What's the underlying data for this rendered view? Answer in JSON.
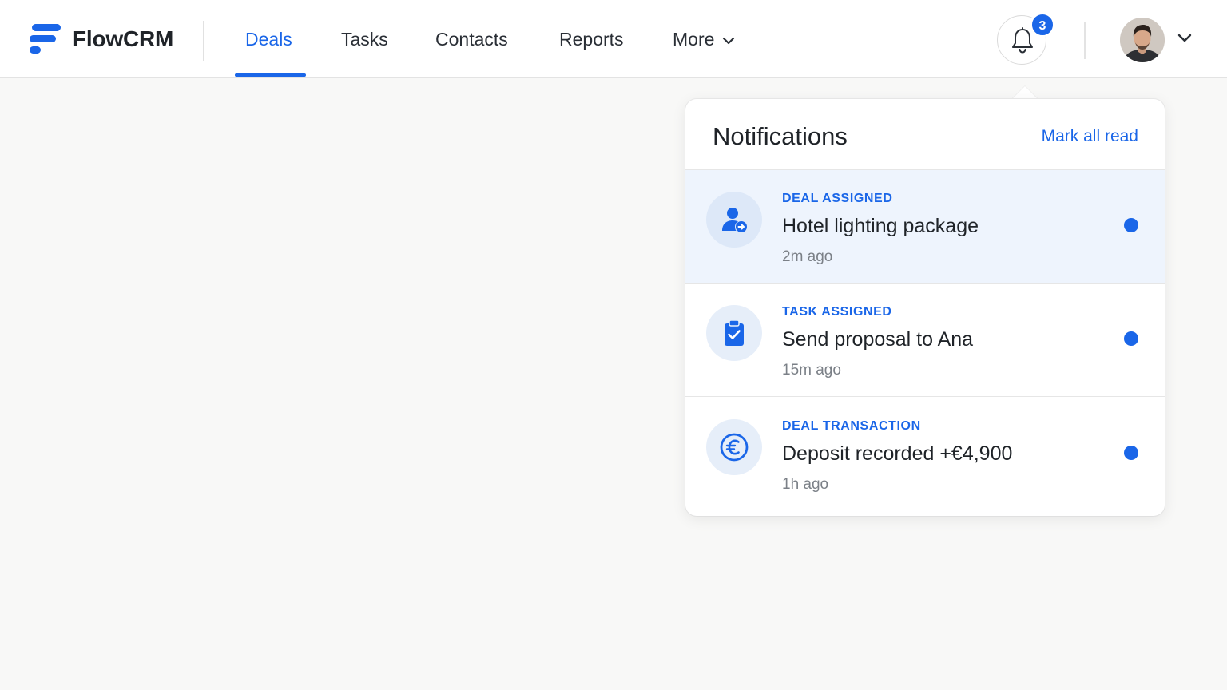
{
  "app": {
    "brand": "FlowCRM",
    "accent_color": "#1a66e8"
  },
  "nav": {
    "items": [
      {
        "label": "Deals",
        "active": true
      },
      {
        "label": "Tasks",
        "active": false
      },
      {
        "label": "Contacts",
        "active": false
      },
      {
        "label": "Reports",
        "active": false
      },
      {
        "label": "More",
        "active": false,
        "icon": "chevron-down-icon"
      }
    ]
  },
  "header": {
    "notification_count": "3",
    "bell_icon": "bell-icon",
    "avatar_icon": "user-avatar",
    "avatar_menu_icon": "chevron-down-icon"
  },
  "notifications": {
    "title": "Notifications",
    "mark_all_read": "Mark all read",
    "items": [
      {
        "type": "DEAL ASSIGNED",
        "title": "Hotel lighting package",
        "time": "2m ago",
        "icon": "user-assign-icon",
        "unread": true,
        "highlighted": true
      },
      {
        "type": "TASK ASSIGNED",
        "title": "Send proposal to Ana",
        "time": "15m ago",
        "icon": "clipboard-check-icon",
        "unread": true,
        "highlighted": false
      },
      {
        "type": "DEAL TRANSACTION",
        "title": "Deposit recorded +€4,900",
        "time": "1h ago",
        "icon": "euro-icon",
        "unread": true,
        "highlighted": false
      }
    ]
  }
}
